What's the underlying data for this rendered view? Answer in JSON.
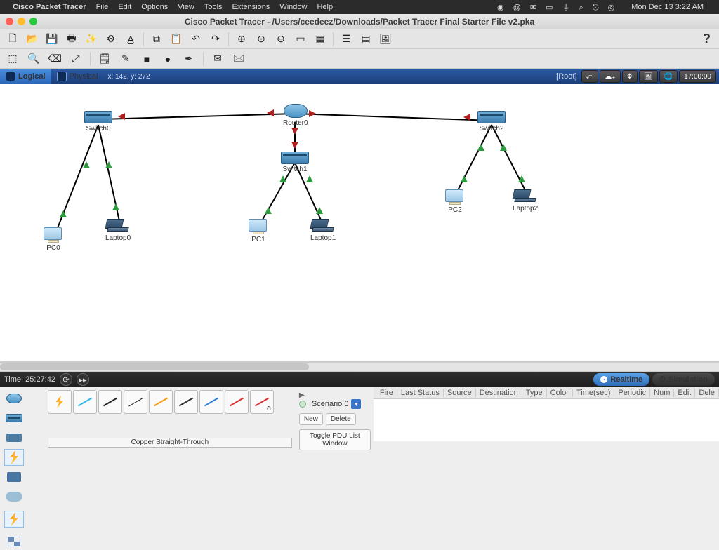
{
  "menubar": {
    "app": "Cisco Packet Tracer",
    "items": [
      "File",
      "Edit",
      "Options",
      "View",
      "Tools",
      "Extensions",
      "Window",
      "Help"
    ],
    "clock": "Mon Dec 13  3:22 AM"
  },
  "window": {
    "title": "Cisco Packet Tracer - /Users/ceedeez/Downloads/Packet Tracer Final Starter File v2.pka"
  },
  "viewbar": {
    "logical": "Logical",
    "physical": "Physical",
    "coords": "x: 142, y: 272",
    "root": "[Root]",
    "clock": "17:00:00"
  },
  "nodes": {
    "switch0": "Switch0",
    "switch1": "Switch1",
    "switch2": "Switch2",
    "router0": "Router0",
    "pc0": "PC0",
    "pc1": "PC1",
    "pc2": "PC2",
    "laptop0": "Laptop0",
    "laptop1": "Laptop1",
    "laptop2": "Laptop2"
  },
  "timebar": {
    "time": "Time: 25:27:42",
    "realtime": "Realtime",
    "simulation": "Simulation"
  },
  "cable_label": "Copper Straight-Through",
  "scenario": {
    "label": "Scenario 0",
    "new": "New",
    "delete": "Delete",
    "toggle": "Toggle PDU List Window"
  },
  "pdu_headers": [
    "Fire",
    "Last Status",
    "Source",
    "Destination",
    "Type",
    "Color",
    "Time(sec)",
    "Periodic",
    "Num",
    "Edit",
    "Dele"
  ]
}
